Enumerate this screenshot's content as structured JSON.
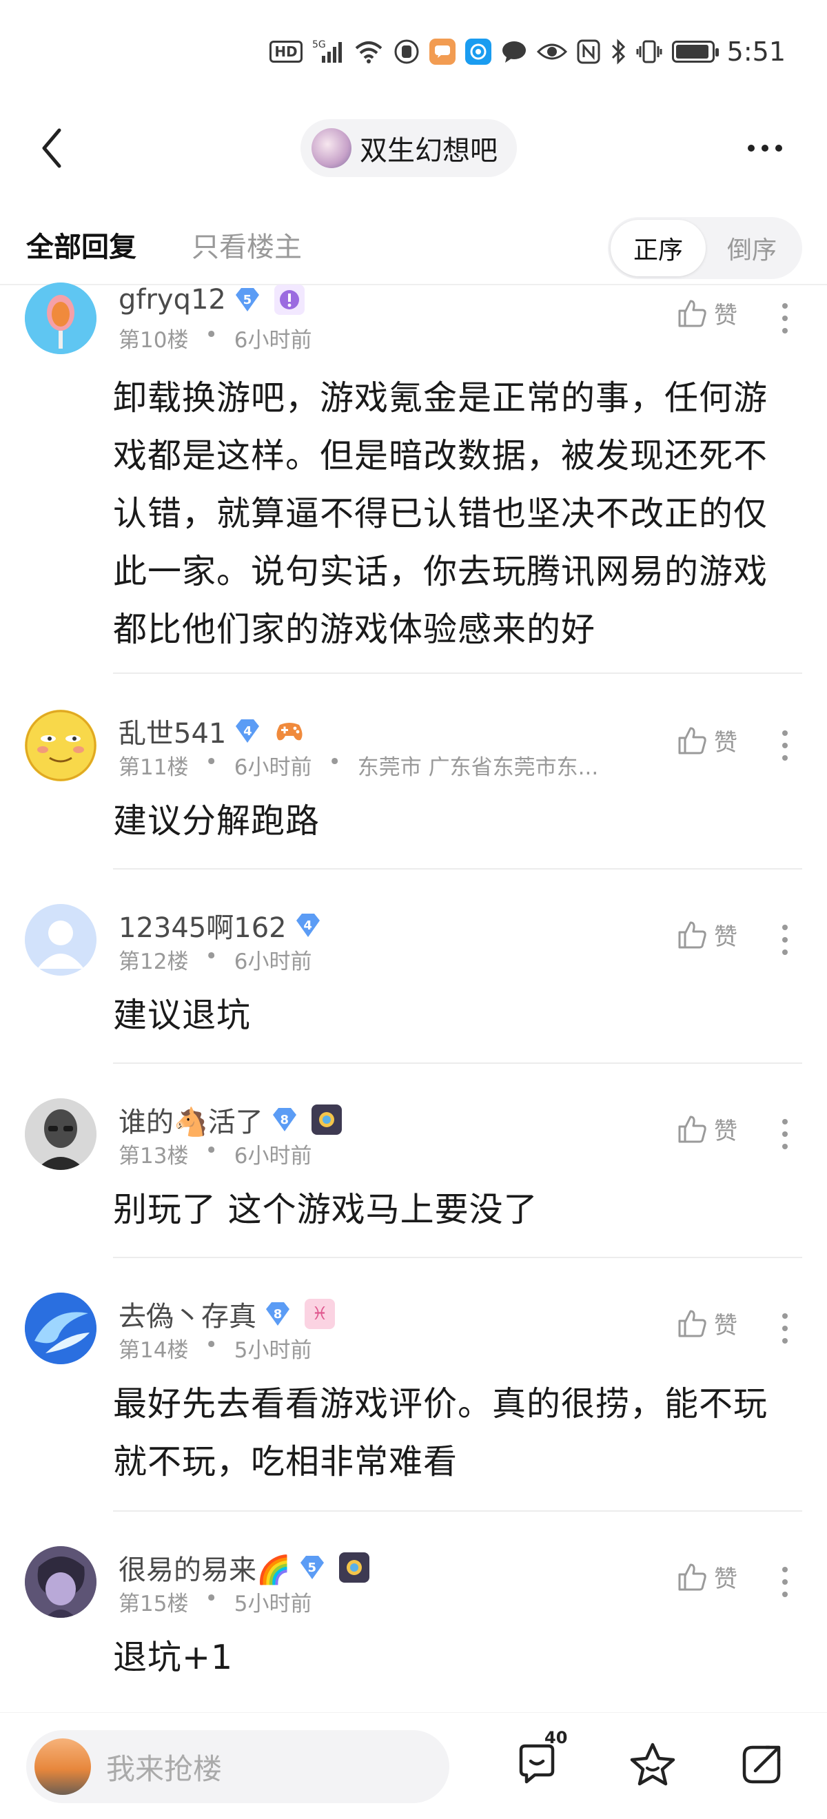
{
  "status_bar": {
    "hd_label": "HD",
    "network_label": "5G",
    "time": "5:51",
    "battery_level": 0.85,
    "app_icon_colors": [
      "#f29c52",
      "#1a9cf0"
    ]
  },
  "header": {
    "forum_name": "双生幻想吧"
  },
  "tabs": {
    "all_replies": "全部回复",
    "op_only": "只看楼主",
    "order_asc": "正序",
    "order_desc": "倒序"
  },
  "like_label": "赞",
  "comments": [
    {
      "username": "gfryq12",
      "level": "5",
      "floor": "第10楼",
      "time": "6小时前",
      "location": "",
      "text_lines": [
        "卸载换游吧，游戏氪金是正常的事，任何游",
        "戏都是这样。但是暗改数据，被发现还死不",
        "认错，就算逼不得已认错也坚决不改正的仅",
        "此一家。说句实话，你去玩腾讯网易的游戏",
        "都比他们家的游戏体验感来的好"
      ]
    },
    {
      "username": "乱世541",
      "level": "4",
      "floor": "第11楼",
      "time": "6小时前",
      "location": "东莞市 广东省东莞市东...",
      "text_lines": [
        "建议分解跑路"
      ]
    },
    {
      "username": "12345啊162",
      "level": "4",
      "floor": "第12楼",
      "time": "6小时前",
      "location": "",
      "text_lines": [
        "建议退坑"
      ]
    },
    {
      "username": "谁的🐴活了",
      "level": "8",
      "floor": "第13楼",
      "time": "6小时前",
      "location": "",
      "text_lines": [
        "别玩了 这个游戏马上要没了"
      ]
    },
    {
      "username": "去偽丶存真",
      "level": "8",
      "floor": "第14楼",
      "time": "5小时前",
      "location": "",
      "text_lines": [
        "最好先去看看游戏评价。真的很捞，能不玩",
        "就不玩，吃相非常难看"
      ]
    },
    {
      "username": "很易的易来🌈",
      "level": "5",
      "floor": "第15楼",
      "time": "5小时前",
      "location": "",
      "text_lines": [
        "退坑+1"
      ]
    }
  ],
  "bottom_bar": {
    "placeholder": "我来抢楼",
    "reply_count": "40"
  },
  "colors": {
    "level_badge": "#5b9cf5",
    "meta_text": "#999999",
    "name_text": "#4a4a4a"
  }
}
